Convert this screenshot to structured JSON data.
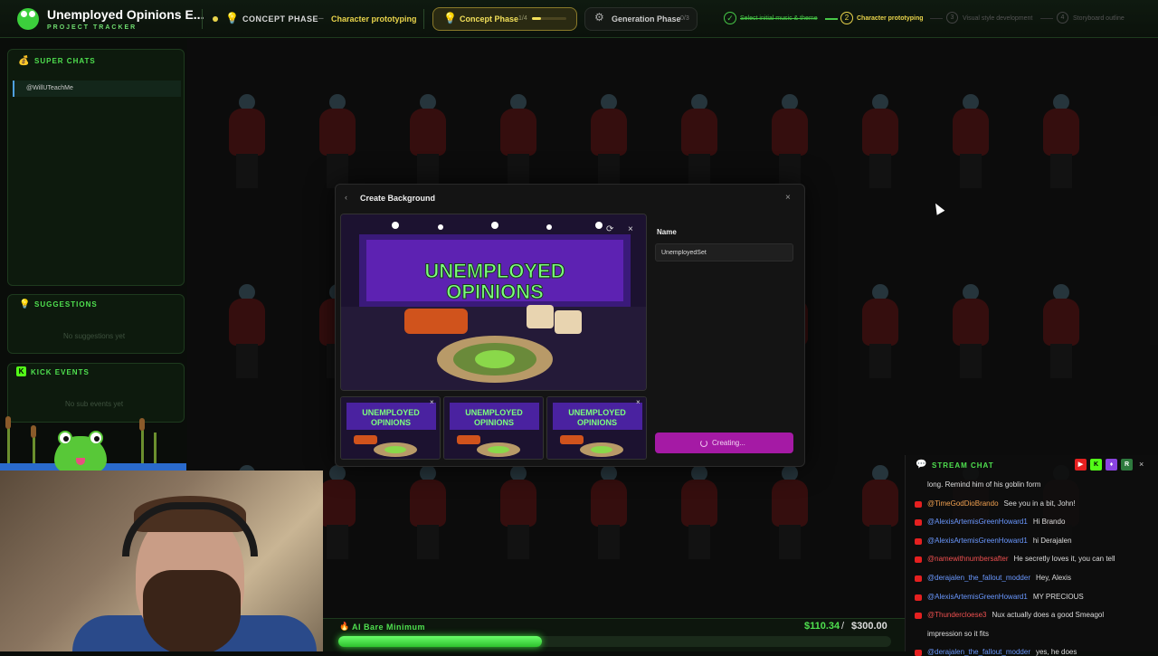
{
  "header": {
    "project_title": "Unemployed Opinions E...",
    "project_subtitle": "PROJECT TRACKER",
    "phase_label": "CONCEPT PHASE",
    "phase_separator": "–",
    "current_step": "Character prototyping",
    "concept_phase": {
      "label": "Concept Phase",
      "count": "1/4",
      "progress": 0.25
    },
    "generation_phase": {
      "label": "Generation Phase",
      "count": "0/3"
    },
    "steps": [
      {
        "number": "✓",
        "label": "Select initial music & theme",
        "state": "done"
      },
      {
        "number": "2",
        "label": "Character prototyping",
        "state": "active"
      },
      {
        "number": "3",
        "label": "Visual style development",
        "state": "pending"
      },
      {
        "number": "4",
        "label": "Storyboard outline",
        "state": "pending"
      }
    ]
  },
  "sidebar": {
    "super_chats": {
      "title": "SUPER CHATS",
      "items": [
        {
          "user": "@WillUTeachMe"
        }
      ]
    },
    "suggestions": {
      "title": "SUGGESTIONS",
      "empty": "No suggestions yet"
    },
    "kick_events": {
      "title": "KICK EVENTS",
      "icon_letter": "K",
      "empty": "No sub events yet"
    }
  },
  "modal": {
    "back": "‹",
    "title": "Create Background",
    "close": "×",
    "preview": {
      "set_title_line1": "UNEMPLOYED",
      "set_title_line2": "OPINIONS",
      "refresh_icon": "refresh-icon",
      "remove_icon": "close-icon"
    },
    "thumbnails": [
      {
        "line1": "UNEMPLOYED",
        "line2": "OPINIONS",
        "remove": "×"
      },
      {
        "line1": "UNEMPLOYED",
        "line2": "OPINIONS",
        "remove": ""
      },
      {
        "line1": "UNEMPLOYED",
        "line2": "OPINIONS",
        "remove": "×"
      }
    ],
    "name_label": "Name",
    "name_value": "UnemployedSet",
    "create_button_label": "Creating..."
  },
  "goal": {
    "label": "AI Bare Minimum",
    "amount": "$110.34",
    "separator": "/",
    "target": "$300.00",
    "progress": 0.3678
  },
  "chat": {
    "title": "STREAM CHAT",
    "platforms": [
      "▶",
      "K",
      "♦",
      "R"
    ],
    "close": "×",
    "messages": [
      {
        "user": "",
        "text": "long. Remind him of his goblin form",
        "color": "blue",
        "icon": false
      },
      {
        "user": "@TimeGodDioBrando",
        "text": "See you in a bit, John!",
        "color": "orange",
        "icon": true
      },
      {
        "user": "@AlexisArtemisGreenHoward1",
        "text": "Hi Brando",
        "color": "blue",
        "icon": true
      },
      {
        "user": "@AlexisArtemisGreenHoward1",
        "text": "hi Derajalen",
        "color": "blue",
        "icon": true
      },
      {
        "user": "@namewithnumbersafter",
        "text": "He secretly loves it, you can tell",
        "color": "red",
        "icon": true
      },
      {
        "user": "@derajalen_the_fallout_modder",
        "text": "Hey, Alexis",
        "color": "blue",
        "icon": true
      },
      {
        "user": "@AlexisArtemisGreenHoward1",
        "text": "MY PRECIOUS",
        "color": "blue",
        "icon": true
      },
      {
        "user": "@Thundercloese3",
        "text": "Nux actually does a good Smeagol",
        "color": "red",
        "icon": true
      },
      {
        "user": "",
        "text": "impression so it fits",
        "color": "blue",
        "icon": false
      },
      {
        "user": "@derajalen_the_fallout_modder",
        "text": "yes, he does",
        "color": "blue",
        "icon": true
      }
    ]
  },
  "colors": {
    "accent_green": "#4fe04f",
    "phase_yellow": "#e9d44b",
    "create_button": "#a51aa5",
    "youtube_red": "#e52020",
    "kick_green": "#53fc18"
  }
}
